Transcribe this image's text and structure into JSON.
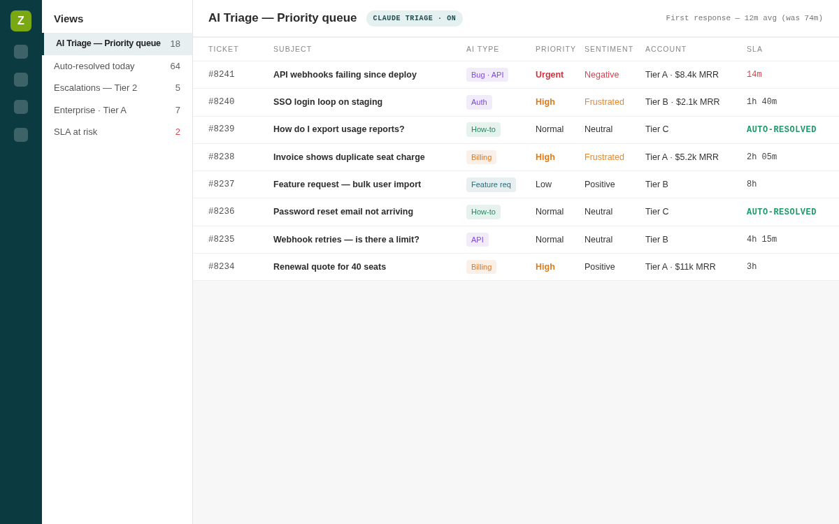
{
  "rail": {
    "logo": "Z"
  },
  "sidebar": {
    "title": "Views",
    "items": [
      {
        "label": "AI Triage — Priority queue",
        "count": "18",
        "selected": true,
        "alert": false
      },
      {
        "label": "Auto-resolved today",
        "count": "64",
        "selected": false,
        "alert": false
      },
      {
        "label": "Escalations — Tier 2",
        "count": "5",
        "selected": false,
        "alert": false
      },
      {
        "label": "Enterprise · Tier A",
        "count": "7",
        "selected": false,
        "alert": false
      },
      {
        "label": "SLA at risk",
        "count": "2",
        "selected": false,
        "alert": true
      }
    ]
  },
  "header": {
    "title": "AI Triage — Priority queue",
    "badge": "CLAUDE TRIAGE · ON",
    "metric": "First response — 12m avg (was 74m)"
  },
  "table": {
    "columns": [
      "TICKET",
      "SUBJECT",
      "AI TYPE",
      "PRIORITY",
      "SENTIMENT",
      "ACCOUNT",
      "SLA"
    ],
    "rows": [
      {
        "ticket": "#8241",
        "subject": "API webhooks failing since deploy",
        "ai_type": {
          "label": "Bug · API",
          "color": "#7c4dd6"
        },
        "priority": {
          "label": "Urgent",
          "kind": "urgent"
        },
        "sentiment": {
          "label": "Negative",
          "kind": "negative"
        },
        "account": "Tier A · $8.4k MRR",
        "sla": {
          "label": "14m",
          "kind": "breach"
        }
      },
      {
        "ticket": "#8240",
        "subject": "SSO login loop on staging",
        "ai_type": {
          "label": "Auth",
          "color": "#7c4dd6"
        },
        "priority": {
          "label": "High",
          "kind": "high"
        },
        "sentiment": {
          "label": "Frustrated",
          "kind": "frustrated"
        },
        "account": "Tier B · $2.1k MRR",
        "sla": {
          "label": "1h 40m",
          "kind": "pending"
        }
      },
      {
        "ticket": "#8239",
        "subject": "How do I export usage reports?",
        "ai_type": {
          "label": "How-to",
          "color": "#1f8a5e"
        },
        "priority": {
          "label": "Normal",
          "kind": "normal"
        },
        "sentiment": {
          "label": "Neutral",
          "kind": "neutral"
        },
        "account": "Tier C",
        "sla": {
          "label": "AUTO-RESOLVED",
          "kind": "resolved"
        }
      },
      {
        "ticket": "#8238",
        "subject": "Invoice shows duplicate seat charge",
        "ai_type": {
          "label": "Billing",
          "color": "#d9782a"
        },
        "priority": {
          "label": "High",
          "kind": "high"
        },
        "sentiment": {
          "label": "Frustrated",
          "kind": "frustrated"
        },
        "account": "Tier A · $5.2k MRR",
        "sla": {
          "label": "2h 05m",
          "kind": "pending"
        }
      },
      {
        "ticket": "#8237",
        "subject": "Feature request — bulk user import",
        "ai_type": {
          "label": "Feature req",
          "color": "#256b76"
        },
        "priority": {
          "label": "Low",
          "kind": "normal"
        },
        "sentiment": {
          "label": "Positive",
          "kind": "neutral"
        },
        "account": "Tier B",
        "sla": {
          "label": "8h",
          "kind": "pending"
        }
      },
      {
        "ticket": "#8236",
        "subject": "Password reset email not arriving",
        "ai_type": {
          "label": "How-to",
          "color": "#1f8a5e"
        },
        "priority": {
          "label": "Normal",
          "kind": "normal"
        },
        "sentiment": {
          "label": "Neutral",
          "kind": "neutral"
        },
        "account": "Tier C",
        "sla": {
          "label": "AUTO-RESOLVED",
          "kind": "resolved"
        }
      },
      {
        "ticket": "#8235",
        "subject": "Webhook retries — is there a limit?",
        "ai_type": {
          "label": "API",
          "color": "#7c4dd6"
        },
        "priority": {
          "label": "Normal",
          "kind": "normal"
        },
        "sentiment": {
          "label": "Neutral",
          "kind": "neutral"
        },
        "account": "Tier B",
        "sla": {
          "label": "4h 15m",
          "kind": "pending"
        }
      },
      {
        "ticket": "#8234",
        "subject": "Renewal quote for 40 seats",
        "ai_type": {
          "label": "Billing",
          "color": "#d9782a"
        },
        "priority": {
          "label": "High",
          "kind": "high"
        },
        "sentiment": {
          "label": "Positive",
          "kind": "neutral"
        },
        "account": "Tier A · $11k MRR",
        "sla": {
          "label": "3h",
          "kind": "pending"
        }
      }
    ]
  }
}
